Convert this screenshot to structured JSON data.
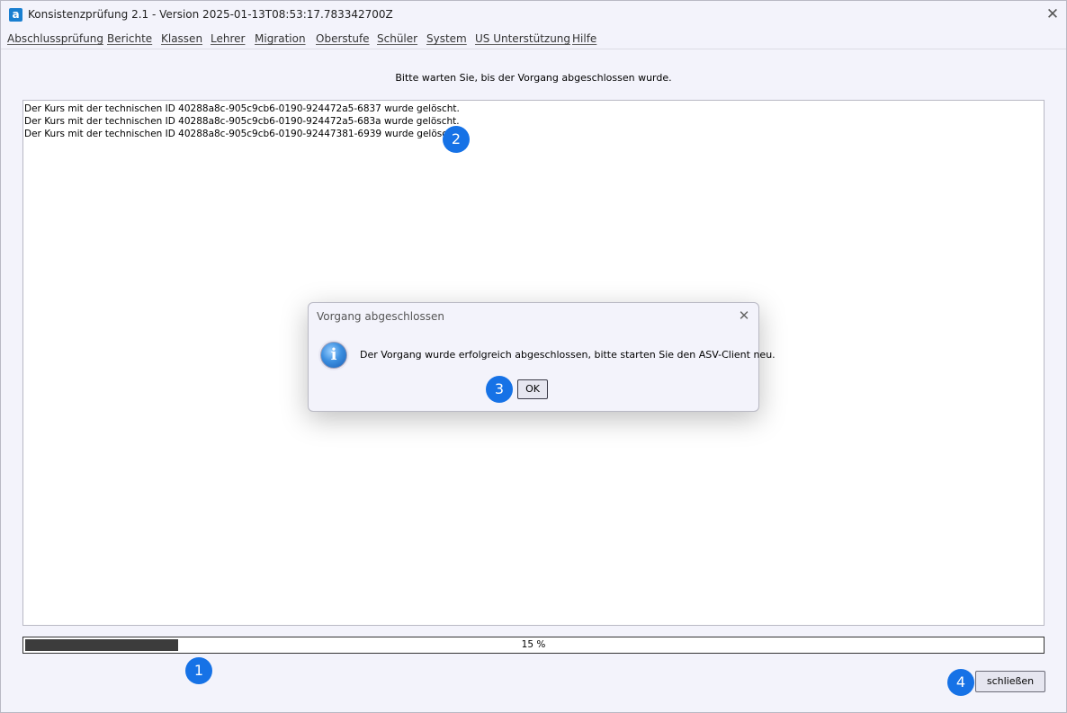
{
  "window": {
    "app_icon_glyph": "a",
    "title": "Konsistenzprüfung 2.1 - Version 2025-01-13T08:53:17.783342700Z"
  },
  "menu": [
    {
      "label": "Abschlussprüfung"
    },
    {
      "label": "Berichte"
    },
    {
      "label": "Klassen"
    },
    {
      "label": "Lehrer"
    },
    {
      "label": "Migration"
    },
    {
      "label": "Oberstufe"
    },
    {
      "label": "Schüler"
    },
    {
      "label": "System"
    },
    {
      "label": "US Unterstützung"
    },
    {
      "label": "Hilfe"
    }
  ],
  "main": {
    "status_text": "Bitte warten Sie, bis der Vorgang abgeschlossen wurde.",
    "log_lines": [
      "Der Kurs mit der technischen ID 40288a8c-905c9cb6-0190-924472a5-6837 wurde gelöscht.",
      "Der Kurs mit der technischen ID 40288a8c-905c9cb6-0190-924472a5-683a wurde gelöscht.",
      "Der Kurs mit der technischen ID 40288a8c-905c9cb6-0190-92447381-6939 wurde gelöscht."
    ],
    "progress_percent": 15,
    "progress_label": "15 %",
    "close_button_label": "schließen"
  },
  "dialog": {
    "title": "Vorgang abgeschlossen",
    "message": "Der Vorgang wurde erfolgreich abgeschlossen, bitte starten Sie den ASV-Client neu.",
    "ok_label": "OK",
    "icon": "info-icon"
  },
  "annotations": [
    "1",
    "2",
    "3",
    "4"
  ],
  "colors": {
    "background": "#f3f3fb",
    "progress_fill": "#3c3c3c",
    "badge": "#1672e6",
    "app_icon": "#1a7fd0"
  }
}
